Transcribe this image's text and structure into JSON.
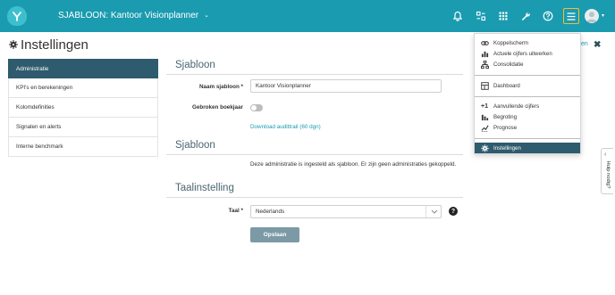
{
  "app": {
    "title": "SJABLOON: Kantoor Visionplanner",
    "caret": "⌄",
    "colors": {
      "topbar": "#1a9bb0",
      "active": "#2e5b6d",
      "accent": "#f2c12e"
    },
    "logo_letter": "Y"
  },
  "topbar_icons": [
    "bell-icon",
    "relations-icon",
    "apps-grid-icon",
    "wrench-icon",
    "help-icon",
    "hamburger-menu-icon",
    "user-avatar"
  ],
  "page": {
    "title": "Instellingen",
    "close_link": "ten",
    "close_icon": "✖"
  },
  "sidebar": {
    "items": [
      {
        "label": "Administratie",
        "active": true
      },
      {
        "label": "KPI's en berekeningen",
        "active": false
      },
      {
        "label": "Kolomdefinities",
        "active": false
      },
      {
        "label": "Signalen en alerts",
        "active": false
      },
      {
        "label": "Interne benchmark",
        "active": false
      }
    ]
  },
  "sections": {
    "template": {
      "title": "Sjabloon",
      "name_label": "Naam sjabloon *",
      "name_value": "Kantoor Visionplanner",
      "fiscal_label": "Gebroken boekjaar",
      "fiscal_on": false,
      "audit_link": "Download audittrail (60 dgn)"
    },
    "template_info": {
      "title": "Sjabloon",
      "text": "Deze administratie is ingesteld als sjabloon. Er zijn geen administraties gekoppeld."
    },
    "language": {
      "title": "Taalinstelling",
      "label": "Taal *",
      "value": "Nederlands",
      "help": "?",
      "save": "Opslaan"
    }
  },
  "dropdown": {
    "items": [
      {
        "label": "Koppelscherm",
        "icon": "link-icon"
      },
      {
        "label": "Actuele cijfers uitwerken",
        "icon": "bar-chart-icon"
      },
      {
        "label": "Consolidatie",
        "icon": "hierarchy-icon"
      },
      {
        "label": "Dashboard",
        "icon": "dashboard-icon"
      },
      {
        "label": "Aanvullende cijfers",
        "icon": "plus-one-icon"
      },
      {
        "label": "Begroting",
        "icon": "budget-chart-icon"
      },
      {
        "label": "Prognose",
        "icon": "forecast-icon"
      },
      {
        "label": "Instellingen",
        "icon": "settings-gear-icon",
        "active": true
      }
    ]
  },
  "help_tab": {
    "label": "Hulp nodig?",
    "chevron": "‹"
  }
}
